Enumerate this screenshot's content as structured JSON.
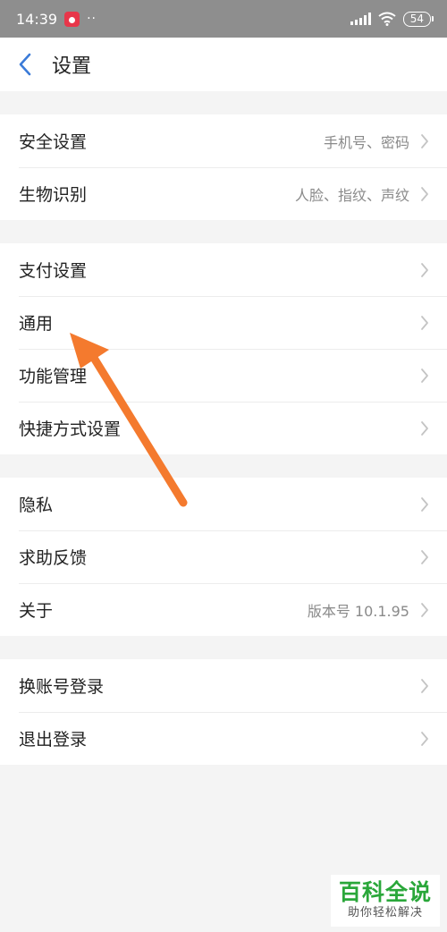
{
  "status_bar": {
    "time": "14:39",
    "dots": "··",
    "battery": "54"
  },
  "nav": {
    "title": "设置"
  },
  "groups": [
    {
      "items": [
        {
          "label": "安全设置",
          "value": "手机号、密码"
        },
        {
          "label": "生物识别",
          "value": "人脸、指纹、声纹"
        }
      ]
    },
    {
      "items": [
        {
          "label": "支付设置",
          "value": ""
        },
        {
          "label": "通用",
          "value": ""
        },
        {
          "label": "功能管理",
          "value": ""
        },
        {
          "label": "快捷方式设置",
          "value": ""
        }
      ]
    },
    {
      "items": [
        {
          "label": "隐私",
          "value": ""
        },
        {
          "label": "求助反馈",
          "value": ""
        },
        {
          "label": "关于",
          "value": "版本号 10.1.95"
        }
      ]
    },
    {
      "items": [
        {
          "label": "换账号登录",
          "value": ""
        },
        {
          "label": "退出登录",
          "value": ""
        }
      ]
    }
  ],
  "watermark": {
    "main": "百科全说",
    "sub": "助你轻松解决"
  },
  "colors": {
    "accent_blue": "#3b7bd8",
    "arrow": "#f47a2e",
    "watermark_green": "#2aa73a"
  }
}
